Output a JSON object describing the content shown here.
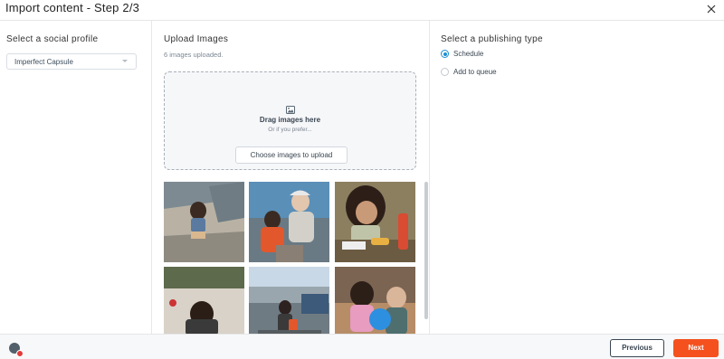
{
  "header": {
    "title": "Import content - Step 2/3",
    "close_icon": "close-icon"
  },
  "profile": {
    "heading": "Select a social profile",
    "selected": "Imperfect Capsule"
  },
  "upload": {
    "heading": "Upload Images",
    "count_text": "6 images uploaded.",
    "drop_title": "Drag images here",
    "drop_sub": "Or if you prefer...",
    "choose_button": "Choose images to upload",
    "image_icon": "image-icon"
  },
  "publishing": {
    "heading": "Select a publishing type",
    "options": [
      {
        "label": "Schedule",
        "selected": true
      },
      {
        "label": "Add to queue",
        "selected": false
      }
    ]
  },
  "footer": {
    "previous": "Previous",
    "next": "Next"
  },
  "colors": {
    "accent": "#f4511e",
    "radio": "#1b8fd3"
  }
}
